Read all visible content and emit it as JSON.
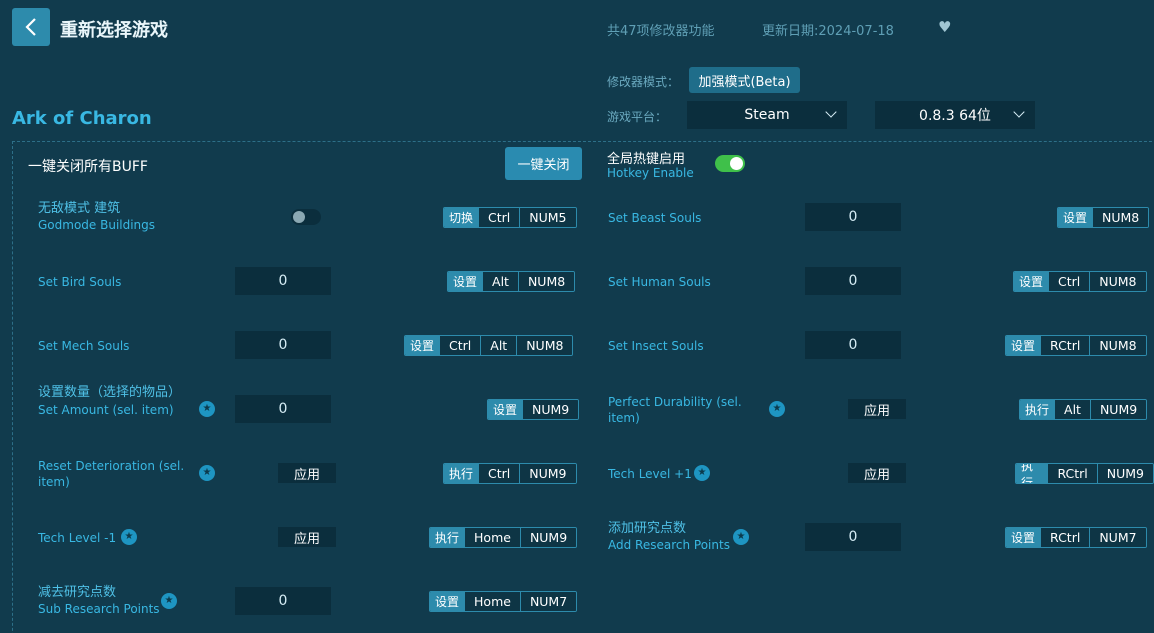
{
  "header": {
    "back_icon": "chevron-left-icon",
    "title": "重新选择游戏",
    "feature_count": "共47项修改器功能",
    "update_date": "更新日期:2024-07-18",
    "favorite_icon": "heart-icon"
  },
  "settings": {
    "mode_label": "修改器模式：",
    "mode_value": "加强模式(Beta)",
    "platform_label": "游戏平台：",
    "platform_value": "Steam",
    "version_value": "0.8.3 64位"
  },
  "game_title": "Ark of Charon",
  "global": {
    "buff_label": "一键关闭所有BUFF",
    "close_all_button": "一键关闭",
    "hotkey_cn": "全局热键启用",
    "hotkey_en": "Hotkey Enable",
    "hotkey_enabled": true
  },
  "features": [
    {
      "cn": "无敌模式 建筑",
      "en": "Godmode Buildings",
      "control": "toggle",
      "toggle_on": false,
      "action": "切换",
      "keys": [
        "Ctrl",
        "NUM5"
      ]
    },
    {
      "en": "Set Beast Souls",
      "control": "input",
      "value": "0",
      "action": "设置",
      "keys": [
        "NUM8"
      ]
    },
    {
      "en": "Set Bird Souls",
      "control": "input",
      "value": "0",
      "action": "设置",
      "keys": [
        "Alt",
        "NUM8"
      ]
    },
    {
      "en": "Set Human Souls",
      "control": "input",
      "value": "0",
      "action": "设置",
      "keys": [
        "Ctrl",
        "NUM8"
      ]
    },
    {
      "en": "Set Mech Souls",
      "control": "input",
      "value": "0",
      "action": "设置",
      "keys": [
        "Ctrl",
        "Alt",
        "NUM8"
      ]
    },
    {
      "en": "Set Insect Souls",
      "control": "input",
      "value": "0",
      "action": "设置",
      "keys": [
        "RCtrl",
        "NUM8"
      ]
    },
    {
      "cn": "设置数量（选择的物品）",
      "en": "Set Amount (sel. item)",
      "star": true,
      "control": "input",
      "value": "0",
      "action": "设置",
      "keys": [
        "NUM9"
      ]
    },
    {
      "en": "Perfect Durability (sel. item)",
      "star": true,
      "control": "apply",
      "apply_label": "应用",
      "action": "执行",
      "keys": [
        "Alt",
        "NUM9"
      ]
    },
    {
      "en": "Reset Deterioration (sel. item)",
      "star": true,
      "control": "apply",
      "apply_label": "应用",
      "action": "执行",
      "keys": [
        "Ctrl",
        "NUM9"
      ]
    },
    {
      "en": "Tech Level +1",
      "star": true,
      "control": "apply",
      "apply_label": "应用",
      "action": "执行",
      "keys": [
        "RCtrl",
        "NUM9"
      ]
    },
    {
      "en": "Tech Level -1",
      "star": true,
      "control": "apply",
      "apply_label": "应用",
      "action": "执行",
      "keys": [
        "Home",
        "NUM9"
      ]
    },
    {
      "cn": "添加研究点数",
      "en": "Add Research Points",
      "star": true,
      "control": "input",
      "value": "0",
      "action": "设置",
      "keys": [
        "RCtrl",
        "NUM7"
      ]
    },
    {
      "cn": "减去研究点数",
      "en": "Sub Research Points",
      "star": true,
      "control": "input",
      "value": "0",
      "action": "设置",
      "keys": [
        "Home",
        "NUM7"
      ]
    }
  ]
}
